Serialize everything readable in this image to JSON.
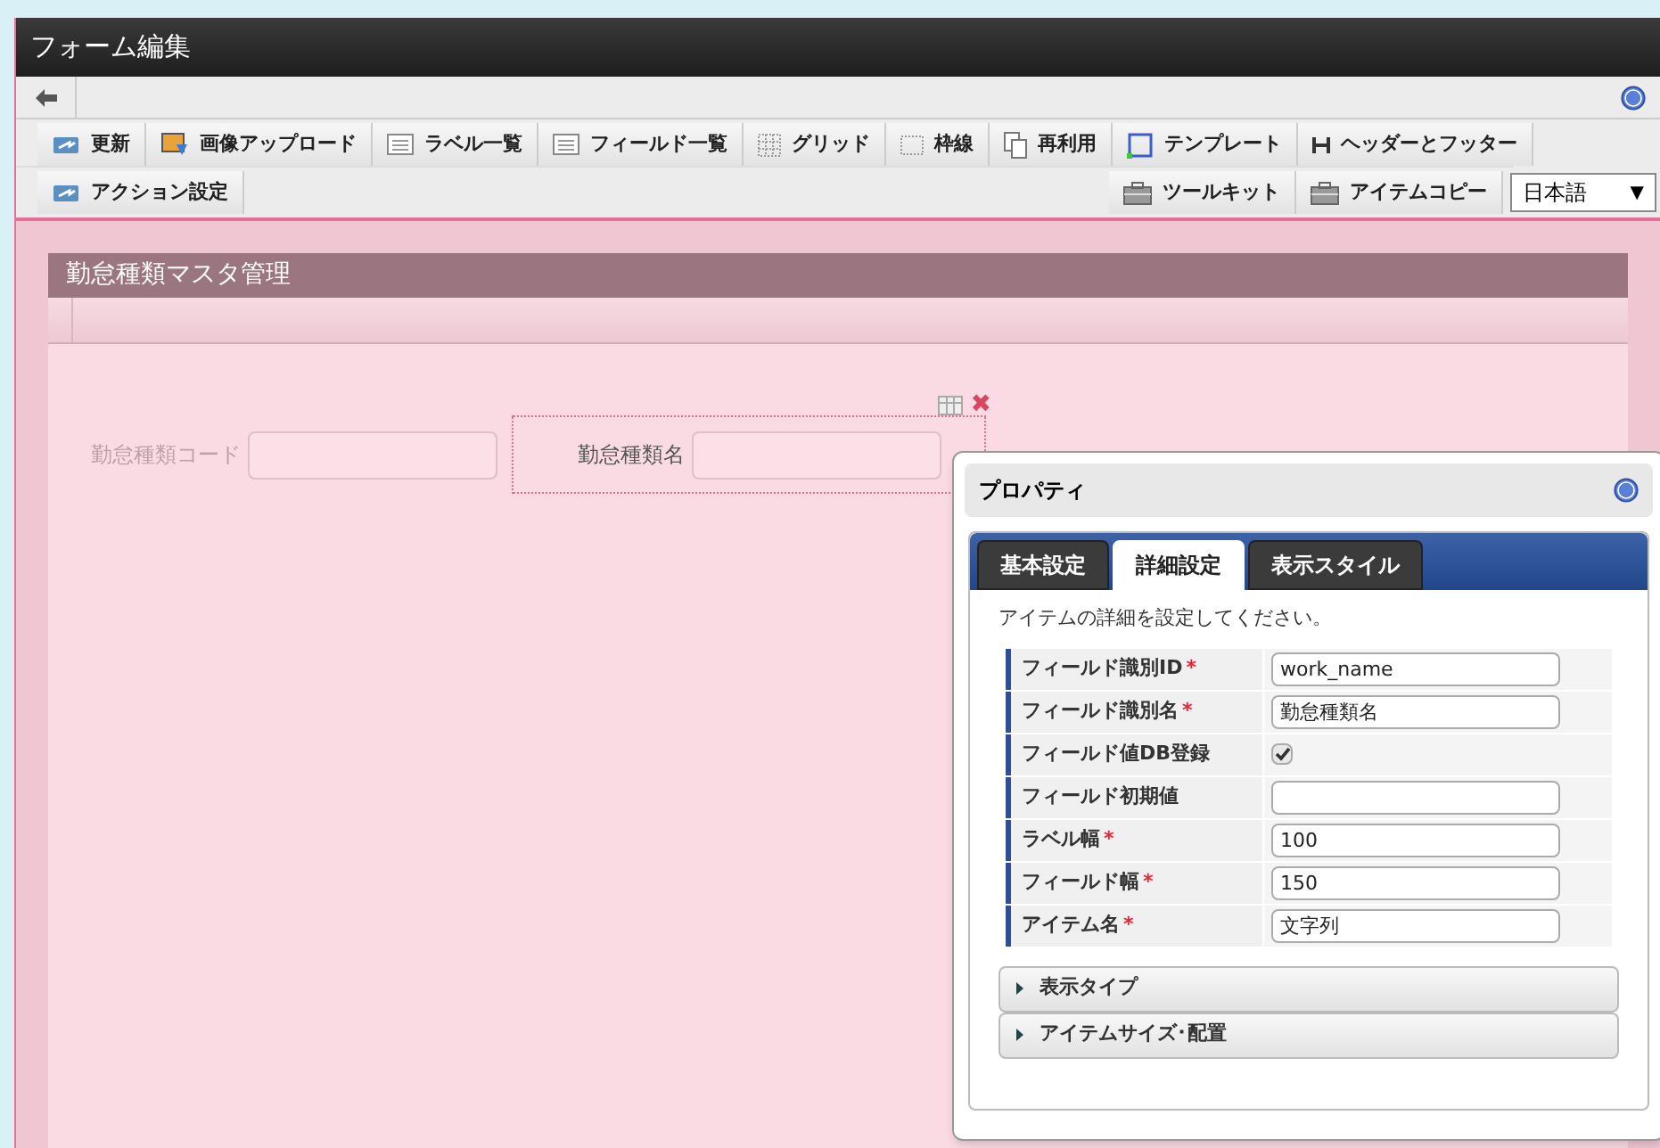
{
  "window": {
    "title": "フォーム編集"
  },
  "toolbar": {
    "row1": [
      {
        "label": "更新",
        "kind": "refresh"
      },
      {
        "label": "画像アップロード",
        "kind": "image"
      },
      {
        "label": "ラベル一覧",
        "kind": "list"
      },
      {
        "label": "フィールド一覧",
        "kind": "list"
      },
      {
        "label": "グリッド",
        "kind": "grid"
      },
      {
        "label": "枠線",
        "kind": "frame"
      },
      {
        "label": "再利用",
        "kind": "copy"
      },
      {
        "label": "テンプレート",
        "kind": "template"
      },
      {
        "label": "ヘッダーとフッター",
        "kind": "h"
      }
    ],
    "row2_left": [
      {
        "label": "アクション設定",
        "kind": "refresh"
      }
    ],
    "row2_right": [
      {
        "label": "ツールキット",
        "kind": "briefcase"
      },
      {
        "label": "アイテムコピー",
        "kind": "briefcase"
      }
    ],
    "language": "日本語",
    "language_caret": "▼"
  },
  "form": {
    "title": "勤怠種類マスタ管理",
    "fields": [
      {
        "label": "勤怠種類コード",
        "selected": false
      },
      {
        "label": "勤怠種類名",
        "selected": true
      }
    ],
    "delete_glyph": "✖"
  },
  "properties": {
    "title": "プロパティ",
    "tabs": [
      {
        "label": "基本設定",
        "selected": false
      },
      {
        "label": "詳細設定",
        "selected": true
      },
      {
        "label": "表示スタイル",
        "selected": false
      }
    ],
    "hint": "アイテムの詳細を設定してください。",
    "required_mark": "*",
    "rows": [
      {
        "label": "フィールド識別ID",
        "required": true,
        "kind": "text",
        "value": "work_name"
      },
      {
        "label": "フィールド識別名",
        "required": true,
        "kind": "text",
        "value": "勤怠種類名"
      },
      {
        "label": "フィールド値DB登録",
        "required": false,
        "kind": "checkbox",
        "checked": true
      },
      {
        "label": "フィールド初期値",
        "required": false,
        "kind": "text",
        "value": ""
      },
      {
        "label": "ラベル幅",
        "required": true,
        "kind": "text",
        "value": "100"
      },
      {
        "label": "フィールド幅",
        "required": true,
        "kind": "text",
        "value": "150"
      },
      {
        "label": "アイテム名",
        "required": true,
        "kind": "text",
        "value": "文字列"
      }
    ],
    "sections": [
      {
        "label": "表示タイプ",
        "expanded": false
      },
      {
        "label": "アイテムサイズ･配置",
        "expanded": false
      }
    ]
  }
}
